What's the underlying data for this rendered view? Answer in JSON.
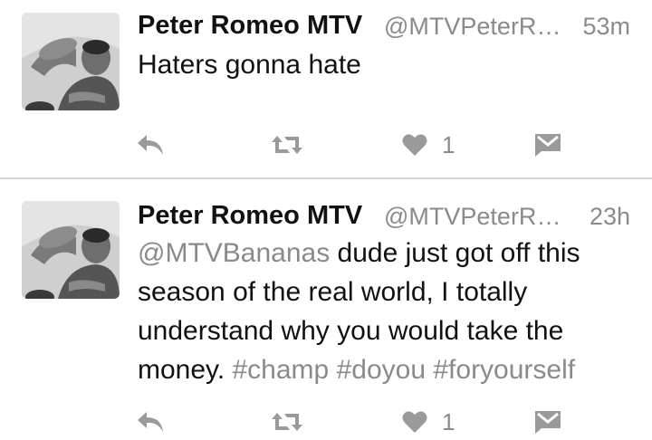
{
  "colors": {
    "text": "#111111",
    "muted": "#8a8a8a",
    "icon": "#9a9a9a",
    "divider": "#d6d6d6"
  },
  "tweets": [
    {
      "name": "Peter Romeo MTV",
      "handle": "@MTVPeterRo...",
      "time": "53m",
      "text": "Haters gonna hate",
      "like_count": "1",
      "icons": [
        "reply-icon",
        "retweet-icon",
        "heart-icon",
        "message-icon"
      ]
    },
    {
      "name": "Peter Romeo MTV",
      "handle": "@MTVPeterRo...",
      "time": "23h",
      "mention": "@MTVBananas",
      "text": " dude just got off this season of the real world, I totally understand why you would take the money. ",
      "hashtags": [
        "#champ",
        "#doyou",
        "#foryourself"
      ],
      "like_count": "1",
      "icons": [
        "reply-icon",
        "retweet-icon",
        "heart-icon",
        "message-icon"
      ]
    }
  ]
}
